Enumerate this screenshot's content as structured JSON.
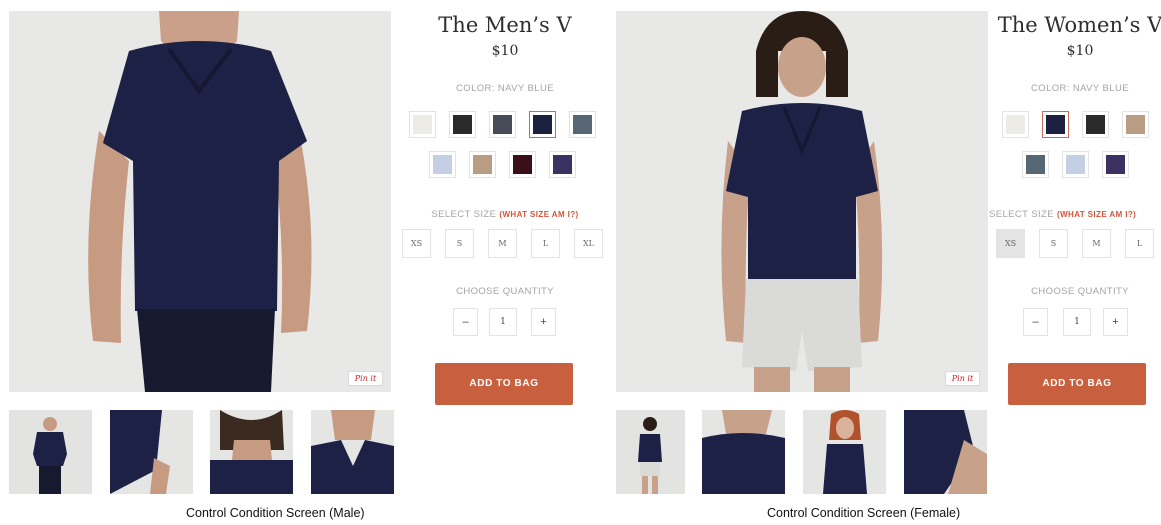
{
  "colors": {
    "navy": "#1c2145",
    "add_to_bag": "#c8603f",
    "link_red": "#d2553a",
    "label_gray": "#a4a4a4"
  },
  "male": {
    "title": "The Men’s V",
    "price": "$10",
    "color_label": "COLOR: NAVY BLUE",
    "swatches": [
      {
        "name": "white",
        "hex": "#ecebe6"
      },
      {
        "name": "black",
        "hex": "#2a2a2a"
      },
      {
        "name": "charcoal",
        "hex": "#474a57"
      },
      {
        "name": "navy",
        "hex": "#1d2140",
        "selected": true
      },
      {
        "name": "slate",
        "hex": "#566773"
      },
      {
        "name": "light-blue",
        "hex": "#c4cfe3"
      },
      {
        "name": "tan",
        "hex": "#b89c83"
      },
      {
        "name": "burgundy",
        "hex": "#3a0f18"
      },
      {
        "name": "purple",
        "hex": "#3b3261"
      }
    ],
    "size_label": "SELECT SIZE",
    "size_link": "(WHAT SIZE AM I?)",
    "sizes": [
      "XS",
      "S",
      "M",
      "L",
      "XL"
    ],
    "quantity_label": "CHOOSE QUANTITY",
    "quantity": "1",
    "minus": "–",
    "plus": "+",
    "add_to_bag": "ADD TO BAG",
    "pin_label": "Pin it",
    "caption": "Control Condition Screen (Male)"
  },
  "female": {
    "title": "The Women’s V",
    "price": "$10",
    "color_label": "COLOR: NAVY BLUE",
    "swatches": [
      {
        "name": "white",
        "hex": "#ecebe6"
      },
      {
        "name": "navy",
        "hex": "#1d2140",
        "selected": true
      },
      {
        "name": "black",
        "hex": "#2a2a2a"
      },
      {
        "name": "tan",
        "hex": "#b89c83"
      },
      {
        "name": "slate",
        "hex": "#566773"
      },
      {
        "name": "light-blue",
        "hex": "#c4cfe3"
      },
      {
        "name": "purple",
        "hex": "#3b3261"
      }
    ],
    "size_label": "SELECT SIZE",
    "size_link": "(WHAT SIZE AM I?)",
    "sizes": [
      "XS",
      "S",
      "M",
      "L"
    ],
    "selected_size": "XS",
    "quantity_label": "CHOOSE QUANTITY",
    "quantity": "1",
    "minus": "–",
    "plus": "+",
    "add_to_bag": "ADD TO BAG",
    "pin_label": "Pin it",
    "caption": "Control Condition Screen (Female)"
  }
}
